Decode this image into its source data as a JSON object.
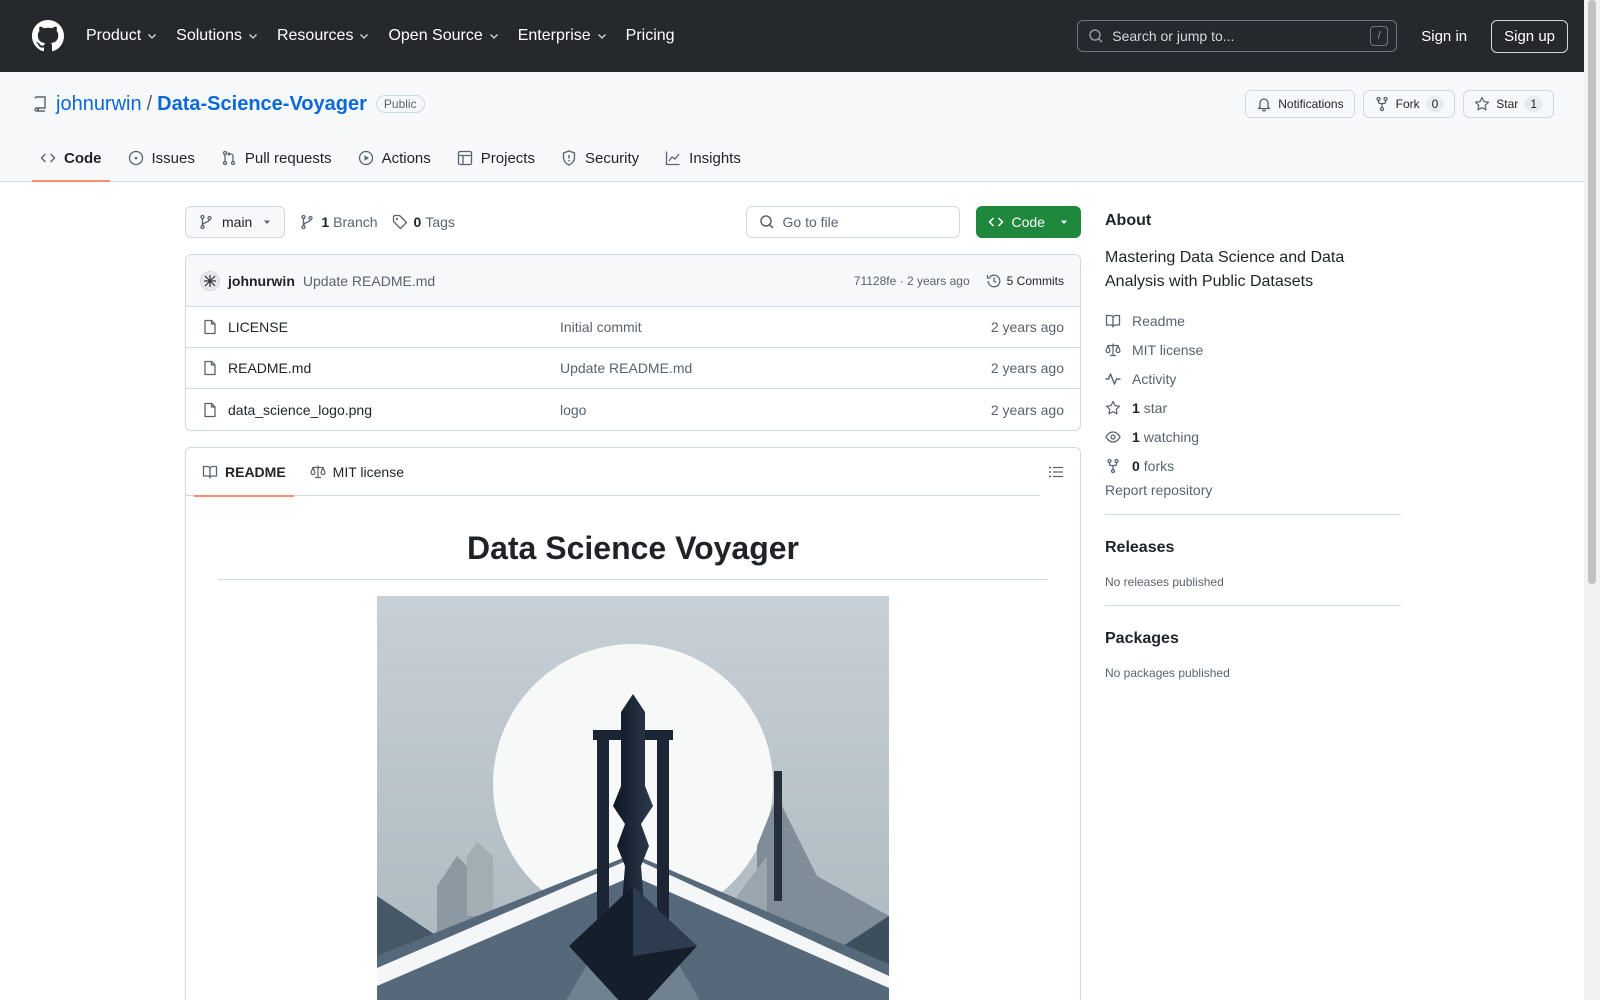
{
  "header": {
    "nav": [
      {
        "label": "Product",
        "dropdown": true
      },
      {
        "label": "Solutions",
        "dropdown": true
      },
      {
        "label": "Resources",
        "dropdown": true
      },
      {
        "label": "Open Source",
        "dropdown": true
      },
      {
        "label": "Enterprise",
        "dropdown": true
      },
      {
        "label": "Pricing",
        "dropdown": false
      }
    ],
    "search_placeholder": "Search or jump to...",
    "search_shortcut": "/",
    "sign_in": "Sign in",
    "sign_up": "Sign up"
  },
  "repo": {
    "owner": "johnurwin",
    "separator": "/",
    "name": "Data-Science-Voyager",
    "visibility": "Public",
    "actions": {
      "notifications": "Notifications",
      "fork_label": "Fork",
      "fork_count": "0",
      "star_label": "Star",
      "star_count": "1"
    },
    "tabs": [
      {
        "label": "Code",
        "icon": "code-icon"
      },
      {
        "label": "Issues",
        "icon": "issue-icon"
      },
      {
        "label": "Pull requests",
        "icon": "pull-request-icon"
      },
      {
        "label": "Actions",
        "icon": "play-icon"
      },
      {
        "label": "Projects",
        "icon": "table-icon"
      },
      {
        "label": "Security",
        "icon": "shield-icon"
      },
      {
        "label": "Insights",
        "icon": "graph-icon"
      }
    ]
  },
  "toolbar": {
    "branch": "main",
    "branch_count": "1",
    "branch_label": "Branch",
    "tag_count": "0",
    "tag_label": "Tags",
    "goto_placeholder": "Go to file",
    "code_button": "Code"
  },
  "commit": {
    "user": "johnurwin",
    "message": "Update README.md",
    "meta": "71128fe · 2 years ago",
    "commits": "5 Commits"
  },
  "files": [
    {
      "name": "LICENSE",
      "message": "Initial commit",
      "date": "2 years ago"
    },
    {
      "name": "README.md",
      "message": "Update README.md",
      "date": "2 years ago"
    },
    {
      "name": "data_science_logo.png",
      "message": "logo",
      "date": "2 years ago"
    }
  ],
  "readme": {
    "tab_readme": "README",
    "tab_license": "MIT license",
    "title": "Data Science Voyager"
  },
  "sidebar": {
    "about_title": "About",
    "description": "Mastering Data Science and Data Analysis with Public Datasets",
    "readme": "Readme",
    "license": "MIT license",
    "activity": "Activity",
    "stars_count": "1",
    "stars_label": "star",
    "watching_count": "1",
    "watching_label": "watching",
    "forks_count": "0",
    "forks_label": "forks",
    "report": "Report repository",
    "releases_title": "Releases",
    "releases_empty": "No releases published",
    "packages_title": "Packages",
    "packages_empty": "No packages published"
  },
  "colors": {
    "header_bg": "#25292e",
    "link": "#0969da",
    "primary_button": "#1f883d",
    "tab_underline": "#fd8c73"
  }
}
